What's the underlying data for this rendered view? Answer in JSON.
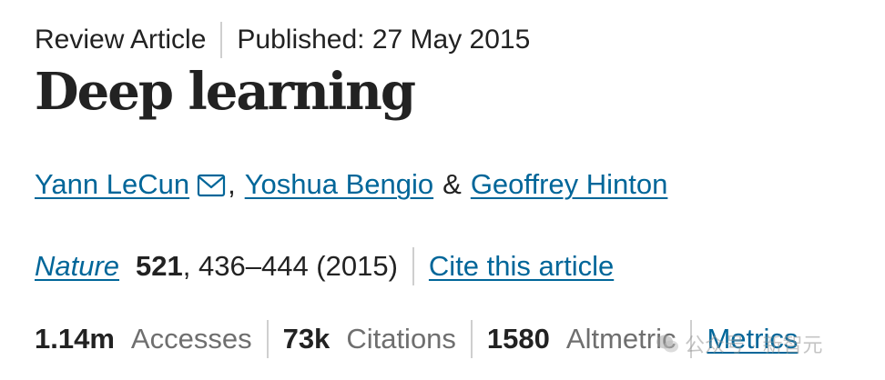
{
  "article": {
    "type": "Review Article",
    "published": "Published: 27 May 2015",
    "title": "Deep learning"
  },
  "authors": {
    "first": "Yann LeCun",
    "comma": ",",
    "second": "Yoshua Bengio",
    "amp": "&",
    "third": "Geoffrey Hinton"
  },
  "citation": {
    "journal": "Nature",
    "volume": "521",
    "pages": ", 436–444 (2015)",
    "cite_link": "Cite this article"
  },
  "metrics": {
    "accesses_value": "1.14m",
    "accesses_label": "Accesses",
    "citations_value": "73k",
    "citations_label": "Citations",
    "altmetric_value": "1580",
    "altmetric_label": "Altmetric",
    "metrics_link": "Metrics"
  },
  "watermark": {
    "text": "公众号 · 新智元"
  },
  "colors": {
    "link": "#006699",
    "text": "#222222",
    "muted": "#6f6f6f",
    "separator": "#cfcfcf"
  }
}
